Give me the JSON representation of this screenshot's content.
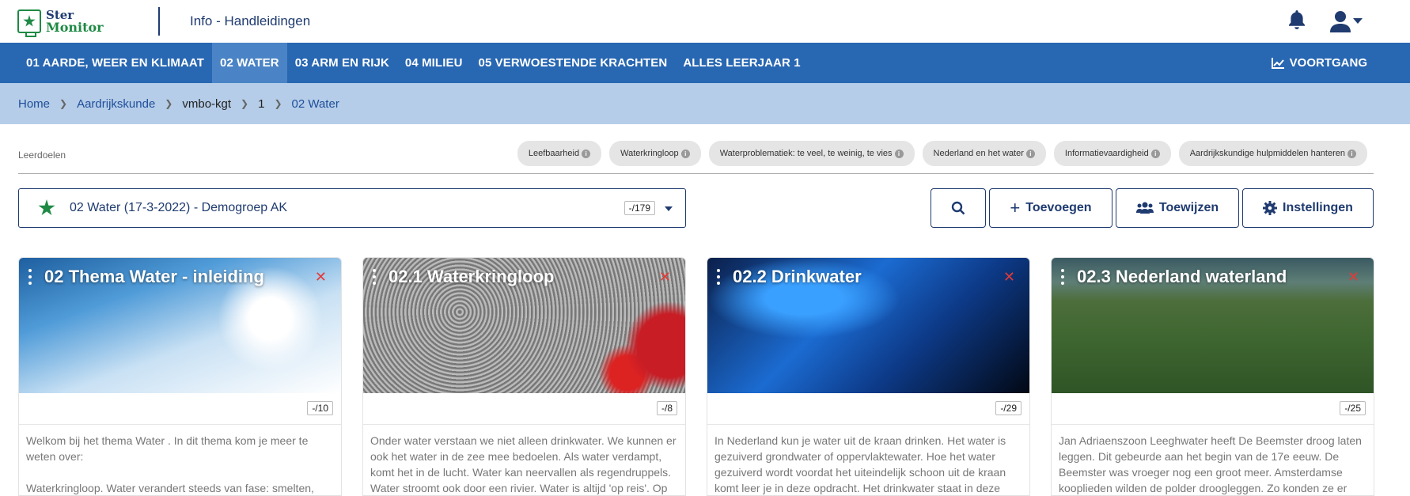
{
  "logo": {
    "line1": "Ster",
    "line2": "Monitor"
  },
  "header": {
    "title": "Info - Handleidingen"
  },
  "nav": {
    "items": [
      {
        "label": "01 AARDE, WEER EN KLIMAAT"
      },
      {
        "label": "02 WATER"
      },
      {
        "label": "03 ARM EN RIJK"
      },
      {
        "label": "04 MILIEU"
      },
      {
        "label": "05 VERWOESTENDE KRACHTEN"
      },
      {
        "label": "ALLES LEERJAAR 1"
      }
    ],
    "active_index": 1,
    "progress_label": "VOORTGANG"
  },
  "breadcrumb": [
    "Home",
    "Aardrijkskunde",
    "vmbo-kgt",
    "1",
    "02 Water"
  ],
  "goals": {
    "label": "Leerdoelen",
    "tags": [
      "Leefbaarheid",
      "Waterkringloop",
      "Waterproblematiek: te veel, te weinig, te vies",
      "Nederland en het water",
      "Informatievaardigheid",
      "Aardrijkskundige hulpmiddelen hanteren"
    ]
  },
  "selector": {
    "label": "02 Water (17-3-2022) - Demogroep AK",
    "count": "-/179"
  },
  "actions": {
    "add": "Toevoegen",
    "assign": "Toewijzen",
    "settings": "Instellingen"
  },
  "cards": [
    {
      "title": "02 Thema Water - inleiding",
      "count": "-/10",
      "desc1": "Welkom bij het thema Water . In dit thema kom je meer te weten over:",
      "desc2": "Waterkringloop. Water verandert steeds van fase: smelten,"
    },
    {
      "title": "02.1 Waterkringloop",
      "count": "-/8",
      "desc1": "Onder water verstaan we niet alleen drinkwater. We kunnen er ook het water in de zee mee bedoelen. Als water verdampt, komt het in de lucht. Water kan neervallen als regendruppels. Water stroomt ook door een rivier. Water is altijd 'op reis'. Op",
      "desc2": ""
    },
    {
      "title": "02.2 Drinkwater",
      "count": "-/29",
      "desc1": "In Nederland kun je water uit de kraan drinken. Het water is gezuiverd grondwater of oppervlaktewater. Hoe het water gezuiverd wordt voordat het uiteindelijk schoon uit de kraan komt leer je in deze opdracht. Het drinkwater staat in deze",
      "desc2": ""
    },
    {
      "title": "02.3 Nederland waterland",
      "count": "-/25",
      "desc1": "Jan Adriaenszoon Leeghwater heeft De Beemster droog laten leggen. Dit gebeurde aan het begin van de 17e eeuw. De Beemster was vroeger nog een groot meer. Amsterdamse kooplieden wilden de polder droogleggen. Zo konden ze er",
      "desc2": ""
    }
  ]
}
